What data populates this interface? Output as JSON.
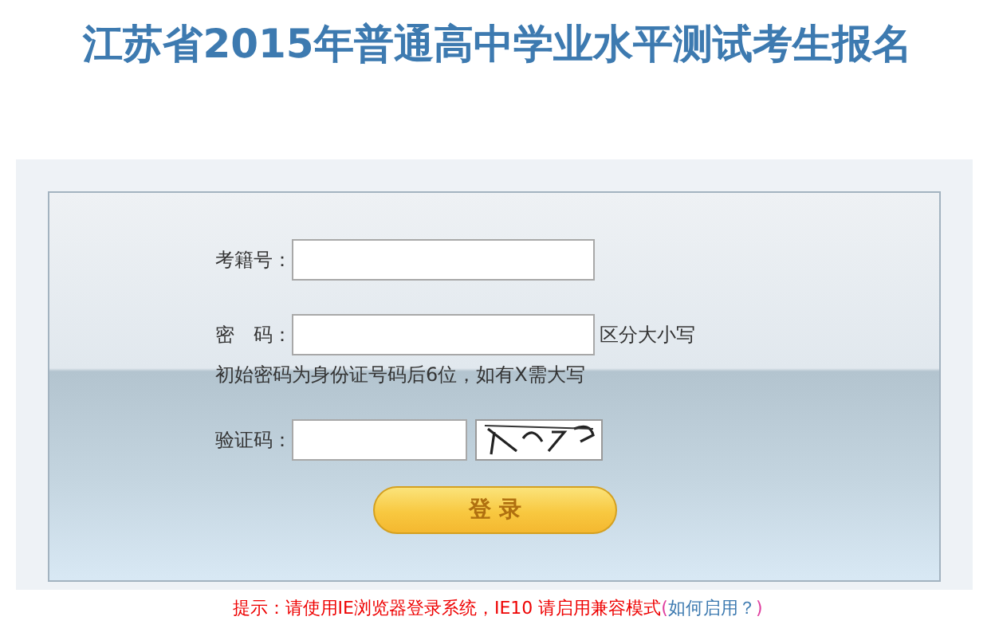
{
  "title": "江苏省2015年普通高中学业水平测试考生报名",
  "form": {
    "fields": [
      {
        "kind": "text",
        "label": "考籍号："
      },
      {
        "kind": "password",
        "label": "密　码：",
        "note": "区分大小写",
        "hint": "初始密码为身份证号码后6位，如有X需大写"
      },
      {
        "kind": "captcha",
        "label": "验证码："
      }
    ],
    "login_button": "登 录"
  },
  "notice": {
    "text": "提示：请使用IE浏览器登录系统，IE10 请启用兼容模式",
    "open": "(",
    "link": "如何启用？",
    "close": ")"
  }
}
